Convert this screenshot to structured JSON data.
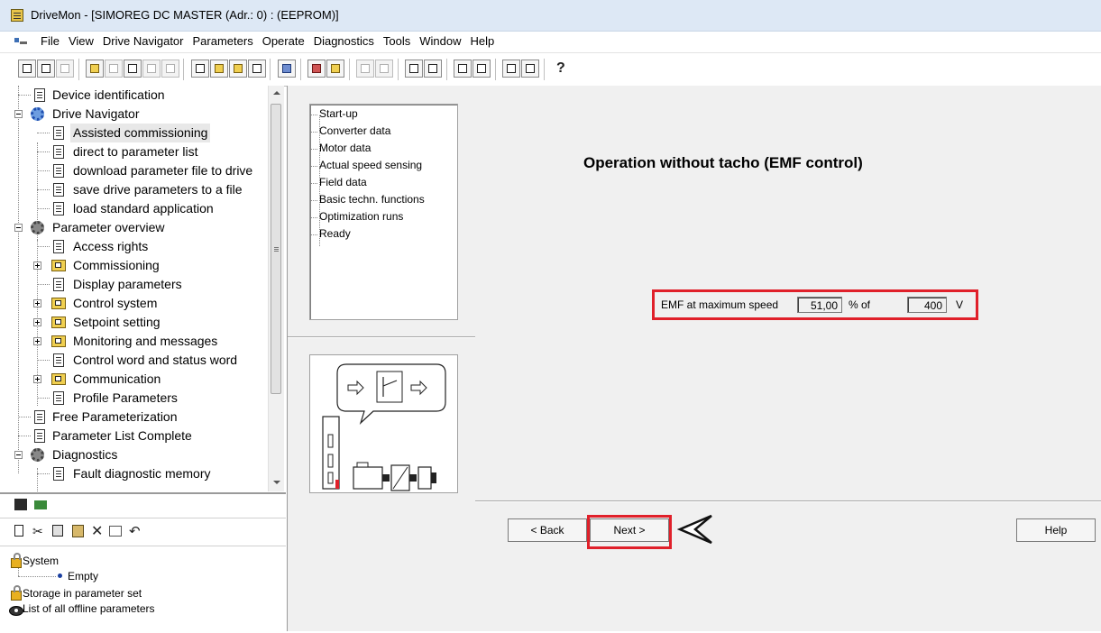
{
  "window": {
    "title": "DriveMon - [SIMOREG DC MASTER  (Adr.: 0) : (EEPROM)]"
  },
  "menu": [
    "File",
    "View",
    "Drive Navigator",
    "Parameters",
    "Operate",
    "Diagnostics",
    "Tools",
    "Window",
    "Help"
  ],
  "tree": {
    "items": [
      {
        "label": "Device identification"
      },
      {
        "label": "Drive Navigator"
      },
      {
        "label": "Assisted commissioning",
        "selected": true
      },
      {
        "label": "direct to parameter list"
      },
      {
        "label": "download parameter file to drive"
      },
      {
        "label": "save drive parameters to a file"
      },
      {
        "label": "load standard application"
      },
      {
        "label": "Parameter overview"
      },
      {
        "label": "Access rights"
      },
      {
        "label": "Commissioning"
      },
      {
        "label": "Display parameters"
      },
      {
        "label": "Control system"
      },
      {
        "label": "Setpoint setting"
      },
      {
        "label": "Monitoring and messages"
      },
      {
        "label": "Control word and status word"
      },
      {
        "label": "Communication"
      },
      {
        "label": "Profile Parameters"
      },
      {
        "label": "Free Parameterization"
      },
      {
        "label": "Parameter List Complete"
      },
      {
        "label": "Diagnostics"
      },
      {
        "label": "Fault diagnostic memory"
      }
    ]
  },
  "offline": {
    "items": [
      {
        "label": "System"
      },
      {
        "label": "Empty"
      },
      {
        "label": "Storage in parameter set"
      },
      {
        "label": "List of all offline parameters"
      }
    ]
  },
  "steps": [
    "Start-up",
    "Converter data",
    "Motor data",
    "Actual speed sensing",
    "Field data",
    "Basic techn. functions",
    "Optimization runs",
    "Ready"
  ],
  "main": {
    "title": "Operation without tacho (EMF control)",
    "emf_label": "EMF at maximum speed",
    "emf_value": "51,00",
    "percent_of": "% of",
    "voltage_value": "400",
    "voltage_unit": "V"
  },
  "buttons": {
    "back": "< Back",
    "next": "Next >",
    "help": "Help"
  },
  "colors": {
    "highlight": "#e0202a",
    "panel_bg": "#f0f0f0"
  },
  "icons": [
    "app-icon",
    "document-icon",
    "folder-icon",
    "gear-icon",
    "lock-icon",
    "eye-icon",
    "pointer-arrow-icon"
  ]
}
